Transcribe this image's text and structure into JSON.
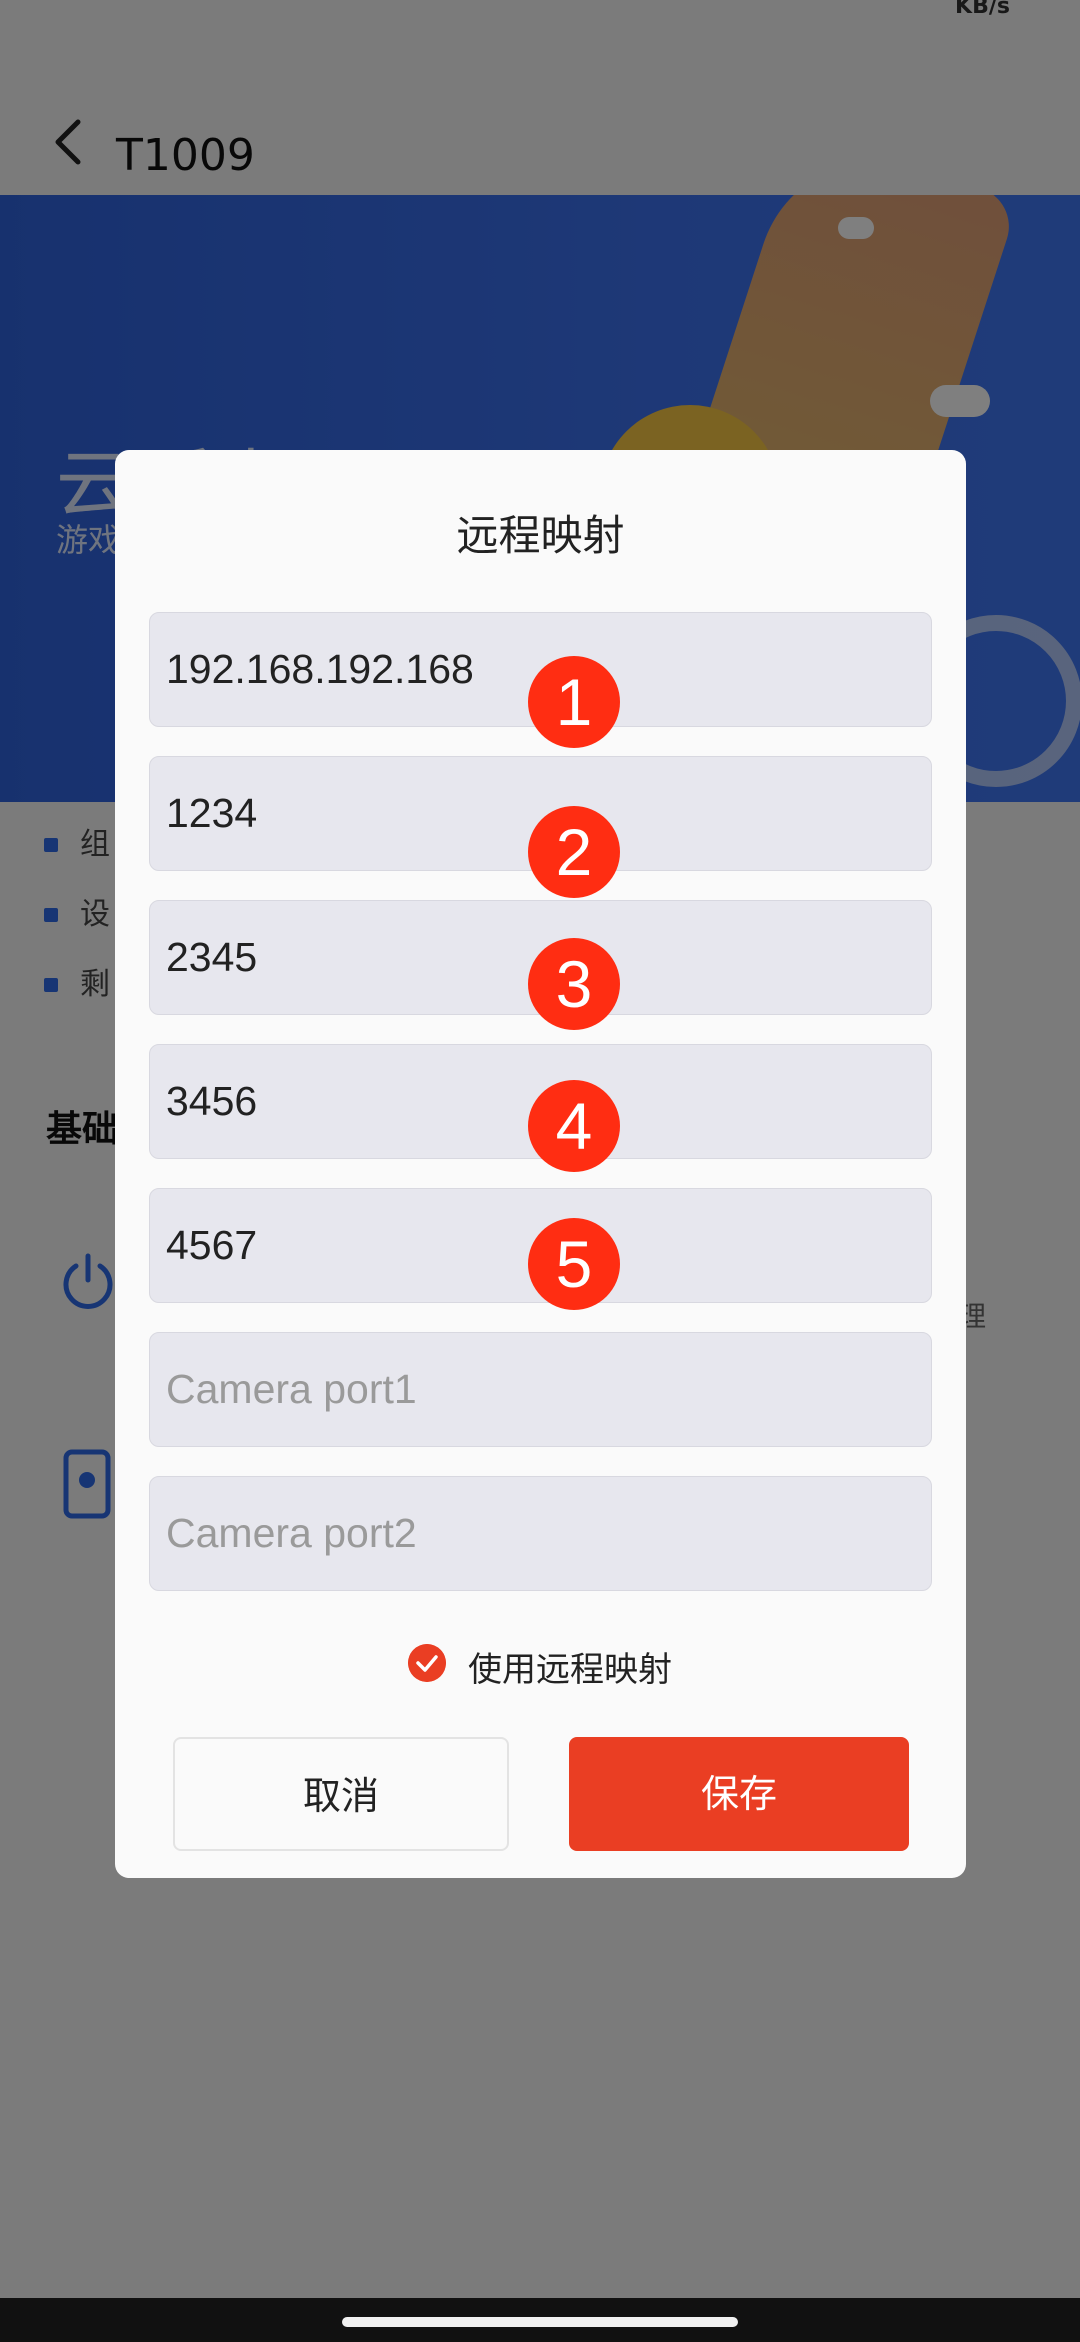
{
  "status_bar": {
    "right_text": "KB/s"
  },
  "header": {
    "title": "T1009"
  },
  "banner": {
    "title": "云手机",
    "subtitle": "游戏"
  },
  "background_list": {
    "items": [
      "组",
      "设",
      "剩"
    ]
  },
  "section": {
    "title": "基础"
  },
  "side_text": "理",
  "dialog": {
    "title": "远程映射",
    "fields": [
      {
        "value": "192.168.192.168",
        "placeholder": "",
        "badge": "1"
      },
      {
        "value": "1234",
        "placeholder": "",
        "badge": "2"
      },
      {
        "value": "2345",
        "placeholder": "",
        "badge": "3"
      },
      {
        "value": "3456",
        "placeholder": "",
        "badge": "4"
      },
      {
        "value": "4567",
        "placeholder": "",
        "badge": "5"
      },
      {
        "value": "",
        "placeholder": "Camera port1"
      },
      {
        "value": "",
        "placeholder": "Camera port2"
      }
    ],
    "checkbox": {
      "label": "使用远程映射",
      "checked": true
    },
    "cancel_label": "取消",
    "save_label": "保存"
  },
  "colors": {
    "accent": "#ea3e23",
    "badge": "#ff2d12",
    "banner": "#3c71ee"
  }
}
